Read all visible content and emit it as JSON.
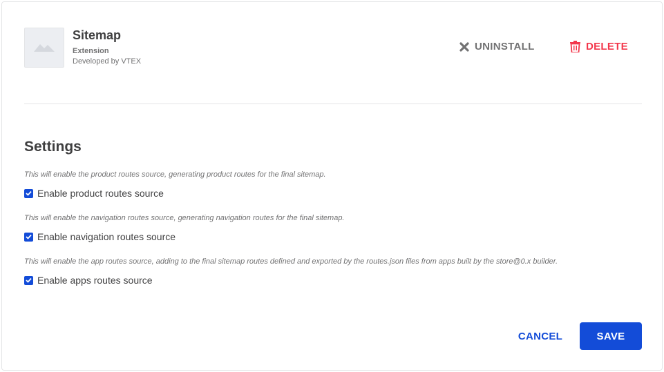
{
  "app": {
    "name": "Sitemap",
    "type": "Extension",
    "developer": "Developed by VTEX",
    "thumbnail_icon": "image-placeholder-icon"
  },
  "actions": {
    "uninstall_label": "UNINSTALL",
    "uninstall_icon": "close-icon",
    "delete_label": "DELETE",
    "delete_icon": "trash-icon"
  },
  "settings": {
    "title": "Settings",
    "items": [
      {
        "description": "This will enable the product routes source, generating product routes for the final sitemap.",
        "label": "Enable product routes source",
        "checked": true
      },
      {
        "description": "This will enable the navigation routes source, generating navigation routes for the final sitemap.",
        "label": "Enable navigation routes source",
        "checked": true
      },
      {
        "description": "This will enable the app routes source, adding to the final sitemap routes defined and exported by the routes.json files from apps built by the store@0.x builder.",
        "label": "Enable apps routes source",
        "checked": true
      }
    ]
  },
  "footer": {
    "cancel_label": "CANCEL",
    "save_label": "SAVE"
  },
  "colors": {
    "primary": "#134cd8",
    "danger": "#f3374b",
    "muted": "#727273",
    "text": "#3f3f40"
  }
}
